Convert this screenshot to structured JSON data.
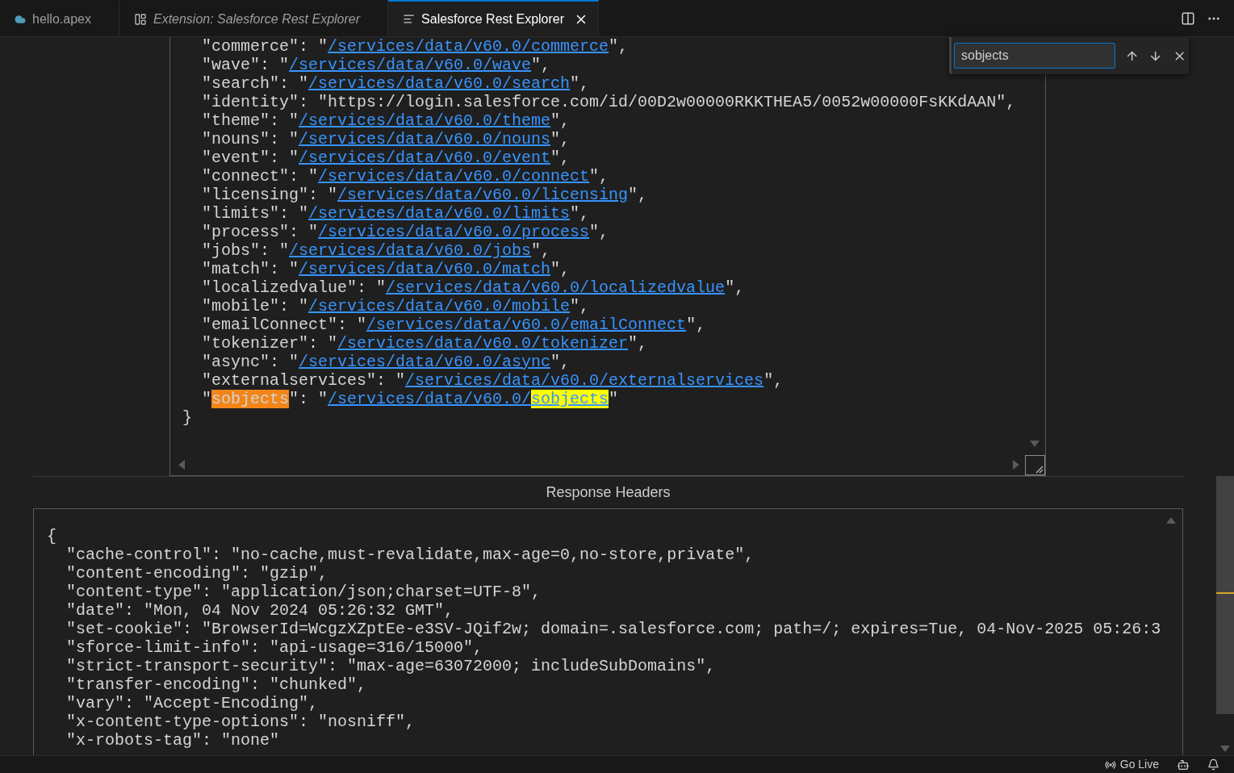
{
  "tabs": [
    {
      "label": "hello.apex",
      "kind": "apex",
      "selected": false,
      "preview": false
    },
    {
      "label": "Extension: Salesforce Rest Explorer",
      "kind": "extension",
      "selected": false,
      "preview": true
    },
    {
      "label": "Salesforce Rest Explorer",
      "kind": "document",
      "selected": true,
      "preview": false
    }
  ],
  "find": {
    "value": "sobjects"
  },
  "response_body": [
    [
      {
        "text": "  \"commerce\": \""
      },
      {
        "text": "/services/data/v60.0/commerce",
        "link": true
      },
      {
        "text": "\","
      }
    ],
    [
      {
        "text": "  \"wave\": \""
      },
      {
        "text": "/services/data/v60.0/wave",
        "link": true
      },
      {
        "text": "\","
      }
    ],
    [
      {
        "text": "  \"search\": \""
      },
      {
        "text": "/services/data/v60.0/search",
        "link": true
      },
      {
        "text": "\","
      }
    ],
    [
      {
        "text": "  \"identity\": \"https://login.salesforce.com/id/00D2w00000RKKTHEA5/0052w00000FsKKdAAN\","
      }
    ],
    [
      {
        "text": "  \"theme\": \""
      },
      {
        "text": "/services/data/v60.0/theme",
        "link": true
      },
      {
        "text": "\","
      }
    ],
    [
      {
        "text": "  \"nouns\": \""
      },
      {
        "text": "/services/data/v60.0/nouns",
        "link": true
      },
      {
        "text": "\","
      }
    ],
    [
      {
        "text": "  \"event\": \""
      },
      {
        "text": "/services/data/v60.0/event",
        "link": true
      },
      {
        "text": "\","
      }
    ],
    [
      {
        "text": "  \"connect\": \""
      },
      {
        "text": "/services/data/v60.0/connect",
        "link": true
      },
      {
        "text": "\","
      }
    ],
    [
      {
        "text": "  \"licensing\": \""
      },
      {
        "text": "/services/data/v60.0/licensing",
        "link": true
      },
      {
        "text": "\","
      }
    ],
    [
      {
        "text": "  \"limits\": \""
      },
      {
        "text": "/services/data/v60.0/limits",
        "link": true
      },
      {
        "text": "\","
      }
    ],
    [
      {
        "text": "  \"process\": \""
      },
      {
        "text": "/services/data/v60.0/process",
        "link": true
      },
      {
        "text": "\","
      }
    ],
    [
      {
        "text": "  \"jobs\": \""
      },
      {
        "text": "/services/data/v60.0/jobs",
        "link": true
      },
      {
        "text": "\","
      }
    ],
    [
      {
        "text": "  \"match\": \""
      },
      {
        "text": "/services/data/v60.0/match",
        "link": true
      },
      {
        "text": "\","
      }
    ],
    [
      {
        "text": "  \"localizedvalue\": \""
      },
      {
        "text": "/services/data/v60.0/localizedvalue",
        "link": true
      },
      {
        "text": "\","
      }
    ],
    [
      {
        "text": "  \"mobile\": \""
      },
      {
        "text": "/services/data/v60.0/mobile",
        "link": true
      },
      {
        "text": "\","
      }
    ],
    [
      {
        "text": "  \"emailConnect\": \""
      },
      {
        "text": "/services/data/v60.0/emailConnect",
        "link": true
      },
      {
        "text": "\","
      }
    ],
    [
      {
        "text": "  \"tokenizer\": \""
      },
      {
        "text": "/services/data/v60.0/tokenizer",
        "link": true
      },
      {
        "text": "\","
      }
    ],
    [
      {
        "text": "  \"async\": \""
      },
      {
        "text": "/services/data/v60.0/async",
        "link": true
      },
      {
        "text": "\","
      }
    ],
    [
      {
        "text": "  \"externalservices\": \""
      },
      {
        "text": "/services/data/v60.0/externalservices",
        "link": true
      },
      {
        "text": "\","
      }
    ],
    [
      {
        "text": "  \""
      },
      {
        "text": "sobjects",
        "match": true,
        "current": true
      },
      {
        "text": "\": \""
      },
      {
        "text": "/services/data/v60.0/",
        "link": true
      },
      {
        "text": "sobjects",
        "link": true,
        "match": true,
        "current": false
      },
      {
        "text": "\""
      }
    ],
    [
      {
        "text": "}"
      }
    ]
  ],
  "headers_title": "Response Headers",
  "headers_body": [
    "{",
    "  \"cache-control\": \"no-cache,must-revalidate,max-age=0,no-store,private\",",
    "  \"content-encoding\": \"gzip\",",
    "  \"content-type\": \"application/json;charset=UTF-8\",",
    "  \"date\": \"Mon, 04 Nov 2024 05:26:32 GMT\",",
    "  \"set-cookie\": \"BrowserId=WcgzXZptEe-e3SV-JQif2w; domain=.salesforce.com; path=/; expires=Tue, 04-Nov-2025 05:26:3",
    "  \"sforce-limit-info\": \"api-usage=316/15000\",",
    "  \"strict-transport-security\": \"max-age=63072000; includeSubDomains\",",
    "  \"transfer-encoding\": \"chunked\",",
    "  \"vary\": \"Accept-Encoding\",",
    "  \"x-content-type-options\": \"nosniff\",",
    "  \"x-robots-tag\": \"none\""
  ],
  "status_bar": {
    "go_live": "Go Live"
  }
}
